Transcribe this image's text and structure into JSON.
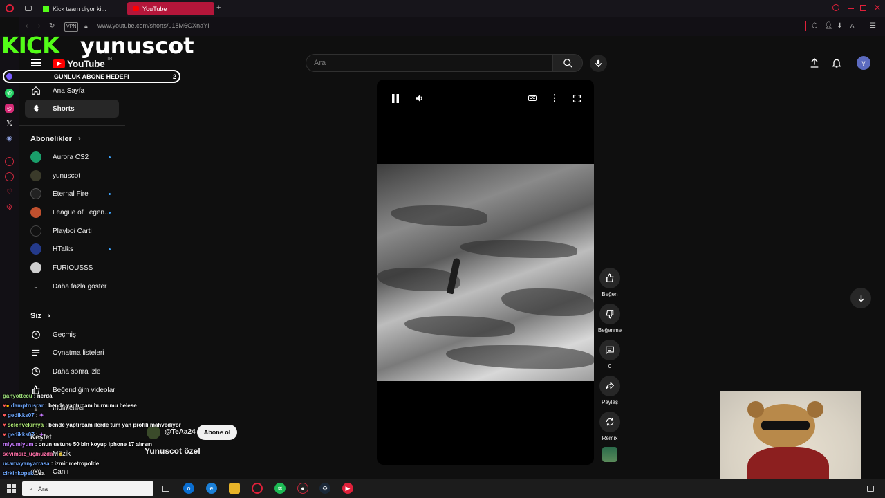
{
  "browser": {
    "tabs": [
      {
        "label": "Kick team diyor ki..."
      },
      {
        "label": "YouTube"
      }
    ],
    "url": "www.youtube.com/shorts/u18M6GXnaYI",
    "vpn_label": "VPN",
    "ai_label": "AI"
  },
  "youtube": {
    "brand": "YouTube",
    "brand_suffix": "TR",
    "search_placeholder": "Ara",
    "avatar_letter": "y"
  },
  "sidebar": {
    "items": [
      {
        "label": "Ana Sayfa",
        "icon": "home-icon"
      },
      {
        "label": "Shorts",
        "icon": "shorts-icon"
      }
    ],
    "subscriptions_title": "Abonelikler",
    "channels": [
      {
        "label": "Aurora CS2",
        "color": "#1a9e6a",
        "new": true
      },
      {
        "label": "yunuscot",
        "color": "#3a3a2a",
        "new": false
      },
      {
        "label": "Eternal Fire",
        "color": "#222222",
        "new": true
      },
      {
        "label": "League of Legen...",
        "color": "#c0502e",
        "new": true
      },
      {
        "label": "Playboi Carti",
        "color": "#111111",
        "new": false
      },
      {
        "label": "HTalks",
        "color": "#243a8a",
        "new": true
      },
      {
        "label": "FURIOUSSS",
        "color": "#cfcfcf",
        "new": false
      }
    ],
    "show_more": "Daha fazla göster",
    "you_title": "Siz",
    "you_items": [
      {
        "label": "Geçmiş",
        "icon": "history-icon"
      },
      {
        "label": "Oynatma listeleri",
        "icon": "playlists-icon"
      },
      {
        "label": "Daha sonra izle",
        "icon": "watch-later-icon"
      },
      {
        "label": "Beğendiğim videolar",
        "icon": "liked-icon"
      },
      {
        "label": "İndirilenler",
        "icon": "download-icon"
      }
    ],
    "explore_title": "Keşfet",
    "explore_items": [
      {
        "label": "Müzik"
      },
      {
        "label": "Canlı"
      }
    ]
  },
  "short": {
    "channel_handle": "@TeAa24",
    "subscribe_label": "Abone ol",
    "title": "Yunuscot özel",
    "actions": {
      "like": "Beğen",
      "dislike": "Beğenme",
      "comments": "0",
      "share": "Paylaş",
      "remix": "Remix"
    }
  },
  "overlay": {
    "kick_logo": "KICK",
    "streamer": "yunuscot",
    "goal_label": "GUNLUK ABONE HEDEFI",
    "goal_count": "2",
    "chat": [
      {
        "user": "ganyottccu",
        "msg": "nerda",
        "color": "#9ee07b"
      },
      {
        "user": "damptrusrar",
        "msg": "bende yaptırcam burnumu belese",
        "color": "#6fa8ff"
      },
      {
        "user": "gedikks07",
        "msg": "",
        "color": "#6fa8ff"
      },
      {
        "user": "selenvekimya",
        "msg": "bende yaptırcam ilerde tüm yan profili mahvediyor",
        "color": "#b6f27a"
      },
      {
        "user": "gedikks07",
        "msg": "",
        "color": "#6fa8ff"
      },
      {
        "user": "miyumiyum",
        "msg": "onun ustune 50 bin koyup iphone 17 alırsın",
        "color": "#c87bff"
      },
      {
        "user": "sevimsiz_uçmuzda",
        "msg": "",
        "color": "#ff6fa8"
      },
      {
        "user": "ucamayanyarrasa",
        "msg": "izmir metropolde",
        "color": "#6fa8ff"
      },
      {
        "user": "cirkinkopek",
        "msg": "sa",
        "color": "#6fa8ff"
      }
    ]
  },
  "taskbar": {
    "search_label": "Ara"
  }
}
